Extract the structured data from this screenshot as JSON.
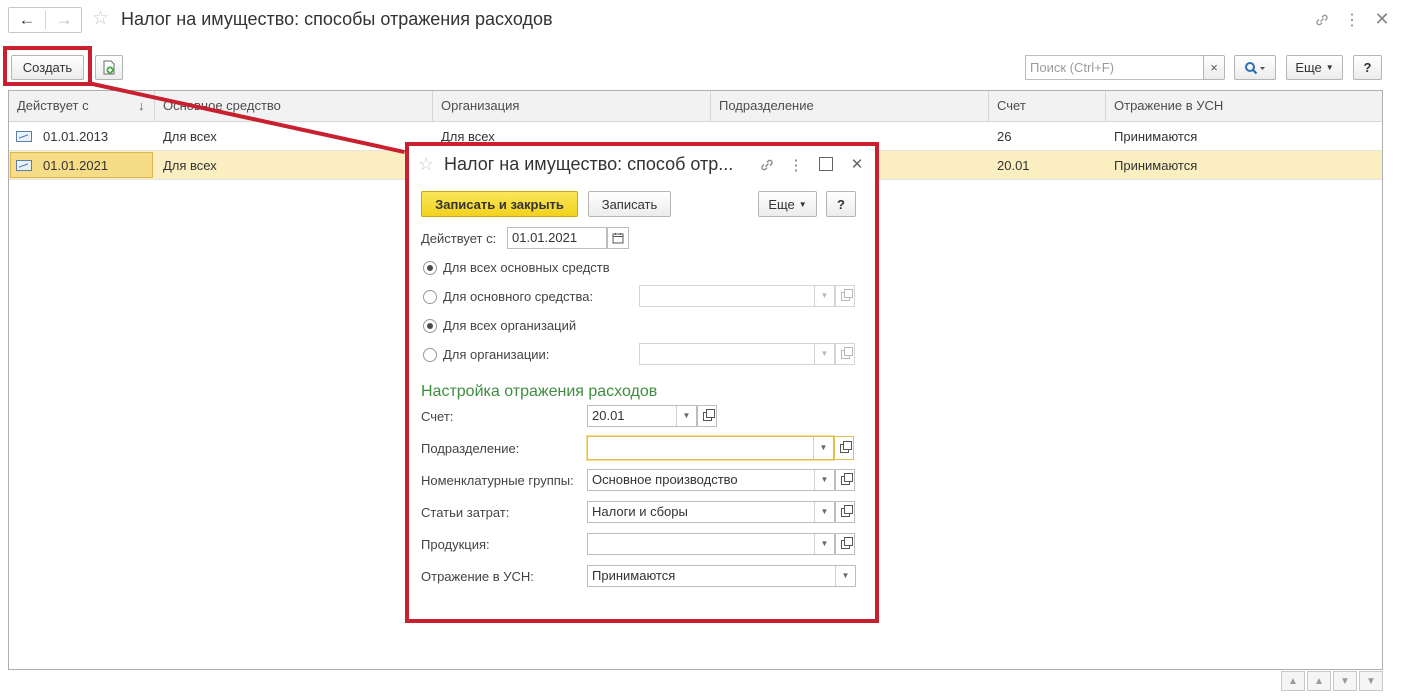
{
  "window": {
    "title": "Налог на имущество: способы отражения расходов"
  },
  "toolbar": {
    "create_label": "Создать",
    "search_placeholder": "Поиск (Ctrl+F)",
    "clear_glyph": "×",
    "more_label": "Еще",
    "help_label": "?"
  },
  "table": {
    "columns": [
      "Действует с",
      "Основное средство",
      "Организация",
      "Подразделение",
      "Счет",
      "Отражение в УСН"
    ],
    "rows": [
      {
        "date": "01.01.2013",
        "asset": "Для всех",
        "org": "Для всех",
        "division": "",
        "account": "26",
        "usn": "Принимаются"
      },
      {
        "date": "01.01.2021",
        "asset": "Для всех",
        "org": "",
        "division": "",
        "account": "20.01",
        "usn": "Принимаются"
      }
    ]
  },
  "dialog": {
    "title": "Налог на имущество: способ отр...",
    "save_close_label": "Записать и закрыть",
    "save_label": "Записать",
    "more_label": "Еще",
    "help_label": "?",
    "valid_from_label": "Действует с:",
    "valid_from_value": "01.01.2021",
    "radio_all_assets": "Для всех основных средств",
    "radio_one_asset": "Для основного средства:",
    "radio_all_orgs": "Для всех организаций",
    "radio_one_org": "Для организации:",
    "section_title": "Настройка отражения расходов",
    "account_label": "Счет:",
    "account_value": "20.01",
    "division_label": "Подразделение:",
    "division_value": "",
    "nomenclature_label": "Номенклатурные группы:",
    "nomenclature_value": "Основное производство",
    "cost_items_label": "Статьи затрат:",
    "cost_items_value": "Налоги и сборы",
    "product_label": "Продукция:",
    "product_value": "",
    "usn_label": "Отражение в УСН:",
    "usn_value": "Принимаются"
  },
  "colors": {
    "accent_yellow": "#f7dd3b",
    "selected_row": "#fbeec0",
    "highlight_red": "#c8202e",
    "section_green": "#3e8e41"
  }
}
